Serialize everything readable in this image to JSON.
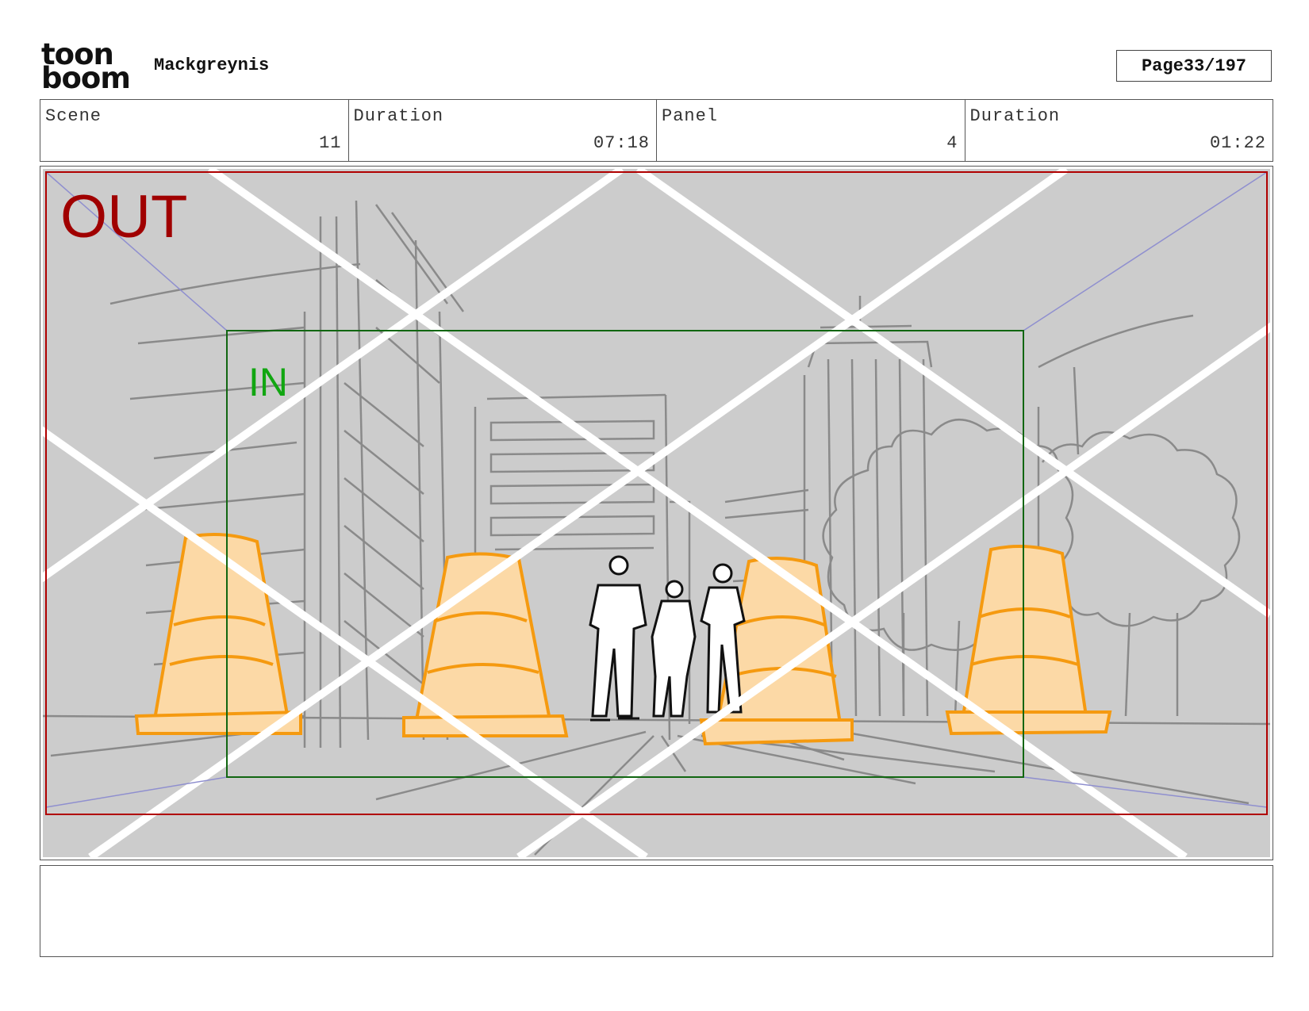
{
  "header": {
    "logo_line1": "toon",
    "logo_line2": "boom",
    "project_name": "Mackgreynis",
    "page_label": "Page",
    "page_number": "33/197"
  },
  "info": [
    {
      "label": "Scene",
      "value": "11"
    },
    {
      "label": "Duration",
      "value": "07:18"
    },
    {
      "label": "Panel",
      "value": "4"
    },
    {
      "label": "Duration",
      "value": "01:22"
    }
  ],
  "panel": {
    "out_label": "OUT",
    "in_label": "IN",
    "colors": {
      "out_frame": "#b00000",
      "in_frame": "#116611",
      "background": "#cccccc",
      "cone_fill": "#fcd9a6",
      "cone_line": "#f59a10",
      "sketch_line": "#8a8a8a"
    }
  },
  "notes": {
    "text": ""
  }
}
